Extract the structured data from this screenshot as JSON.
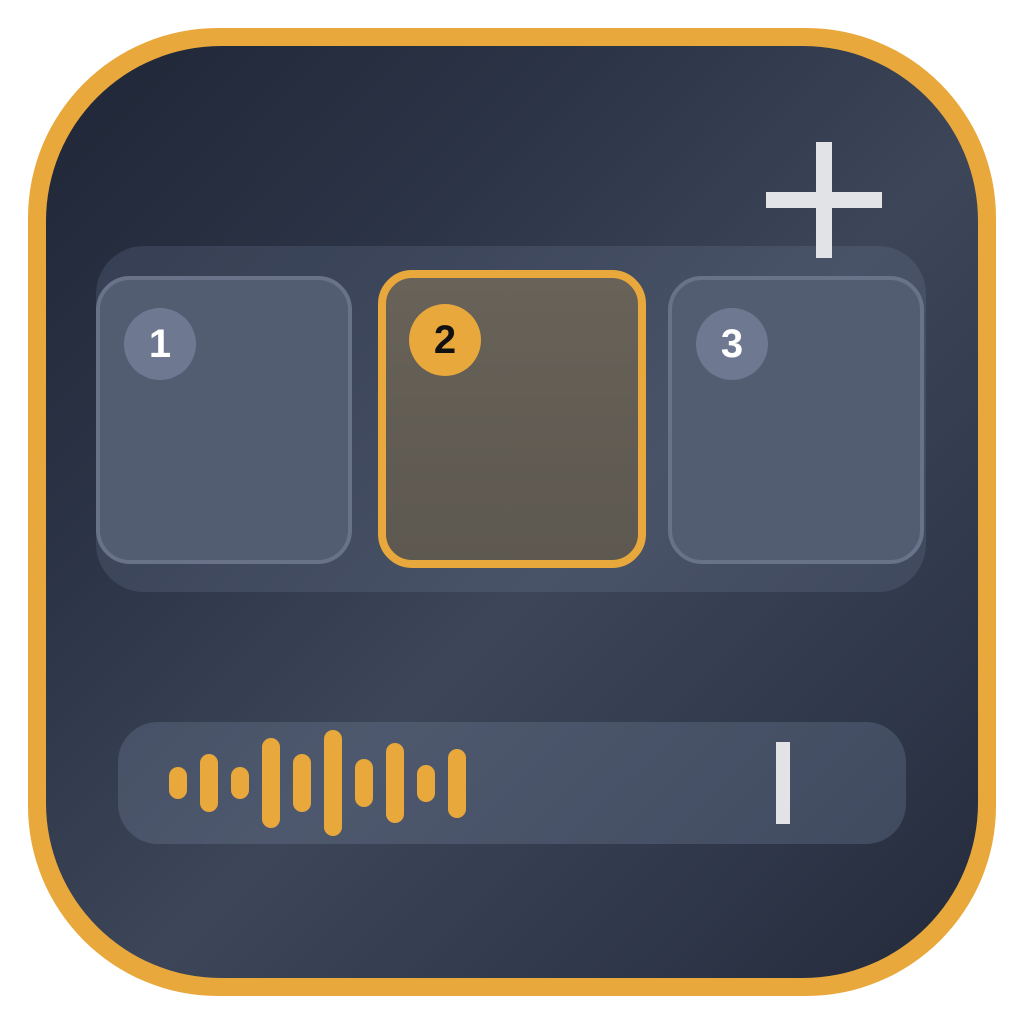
{
  "app": {
    "accent_color": "#e8a83c",
    "panel_color": "#2f374a"
  },
  "toolbar": {
    "add_icon": "plus-icon"
  },
  "workspaces": [
    {
      "number": "1",
      "selected": false
    },
    {
      "number": "2",
      "selected": true
    },
    {
      "number": "3",
      "selected": false
    }
  ],
  "voice_input": {
    "waveform_icon": "audio-waveform-icon",
    "cursor_icon": "text-cursor-icon",
    "waveform_levels": [
      0.3,
      0.55,
      0.3,
      0.85,
      0.55,
      1.0,
      0.45,
      0.75,
      0.35,
      0.65
    ]
  }
}
